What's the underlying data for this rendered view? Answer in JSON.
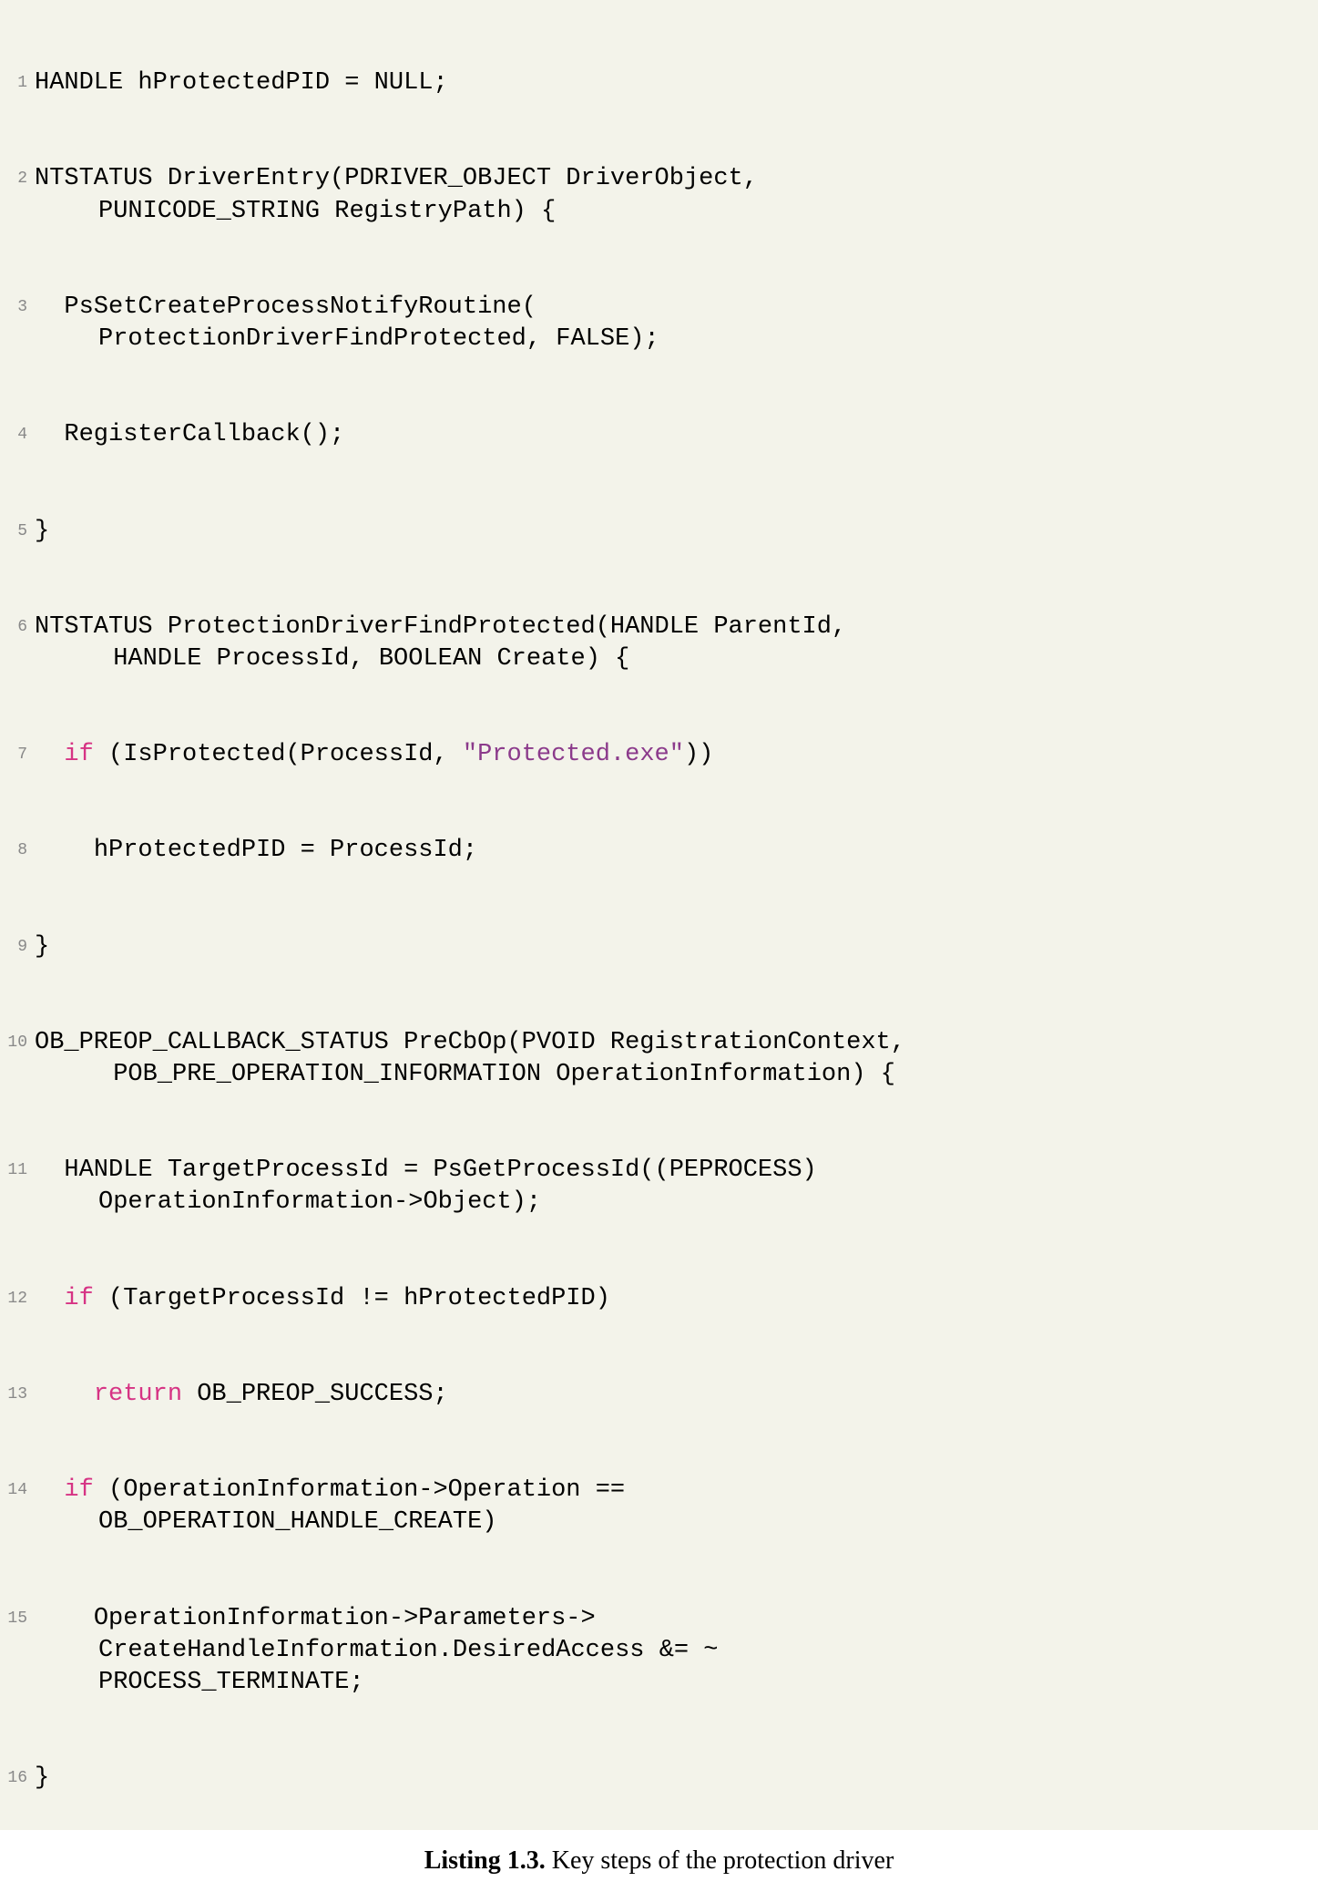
{
  "code": {
    "lines": [
      {
        "num": "1",
        "content": "HANDLE hProtectedPID = NULL;"
      },
      {
        "num": "2",
        "content": "NTSTATUS DriverEntry(PDRIVER_OBJECT DriverObject,\n   PUNICODE_STRING RegistryPath) {"
      },
      {
        "num": "3",
        "content": "  PsSetCreateProcessNotifyRoutine(\n   ProtectionDriverFindProtected, FALSE);"
      },
      {
        "num": "4",
        "content": "  RegisterCallback();"
      },
      {
        "num": "5",
        "content": "}"
      },
      {
        "num": "6",
        "content": "NTSTATUS ProtectionDriverFindProtected(HANDLE ParentId,\n    HANDLE ProcessId, BOOLEAN Create) {"
      },
      {
        "num": "7",
        "content": "  if (IsProtected(ProcessId, \"Protected.exe\"))",
        "hasIf": true,
        "hasString": true
      },
      {
        "num": "8",
        "content": "    hProtectedPID = ProcessId;"
      },
      {
        "num": "9",
        "content": "}"
      },
      {
        "num": "10",
        "content": "OB_PREOP_CALLBACK_STATUS PreCbOp(PVOID RegistrationContext,\n    POB_PRE_OPERATION_INFORMATION OperationInformation) {"
      },
      {
        "num": "11",
        "content": "  HANDLE TargetProcessId = PsGetProcessId((PEPROCESS)\n   OperationInformation->Object);"
      },
      {
        "num": "12",
        "content": "  if (TargetProcessId != hProtectedPID)",
        "hasIf": true
      },
      {
        "num": "13",
        "content": "    return OB_PREOP_SUCCESS;",
        "hasReturn": true
      },
      {
        "num": "14",
        "content": "  if (OperationInformation->Operation ==\n   OB_OPERATION_HANDLE_CREATE)",
        "hasIf": true
      },
      {
        "num": "15",
        "content": "    OperationInformation->Parameters->\n   CreateHandleInformation.DesiredAccess &= ~\n   PROCESS_TERMINATE;"
      },
      {
        "num": "16",
        "content": "}"
      }
    ]
  },
  "caption": {
    "label": "Listing 1.3.",
    "text": " Key steps of the protection driver"
  },
  "tokens": {
    "if": "if",
    "return": "return",
    "string": "\"Protected.exe\""
  },
  "l1": "HANDLE hProtectedPID = NULL;",
  "l2a": "NTSTATUS DriverEntry(PDRIVER_OBJECT DriverObject,",
  "l2b": "PUNICODE_STRING RegistryPath) {",
  "l3a": "  PsSetCreateProcessNotifyRoutine(",
  "l3b": "ProtectionDriverFindProtected, FALSE);",
  "l4": "  RegisterCallback();",
  "l5": "}",
  "l6a": "NTSTATUS ProtectionDriverFindProtected(HANDLE ParentId,",
  "l6b": " HANDLE ProcessId, BOOLEAN Create) {",
  "l7a": "  ",
  "l7b": " (IsProtected(ProcessId, ",
  "l7c": "))",
  "l8": "    hProtectedPID = ProcessId;",
  "l9": "}",
  "l10a": "OB_PREOP_CALLBACK_STATUS PreCbOp(PVOID RegistrationContext,",
  "l10b": " POB_PRE_OPERATION_INFORMATION OperationInformation) {",
  "l11a": "  HANDLE TargetProcessId = PsGetProcessId((PEPROCESS)",
  "l11b": "OperationInformation->Object);",
  "l12a": "  ",
  "l12b": " (TargetProcessId != hProtectedPID)",
  "l13a": "    ",
  "l13b": " OB_PREOP_SUCCESS;",
  "l14a": "  ",
  "l14b": " (OperationInformation->Operation ==",
  "l14c": "OB_OPERATION_HANDLE_CREATE)",
  "l15a": "    OperationInformation->Parameters->",
  "l15b": "CreateHandleInformation.DesiredAccess &= ~",
  "l15c": "PROCESS_TERMINATE;",
  "l16": "}"
}
